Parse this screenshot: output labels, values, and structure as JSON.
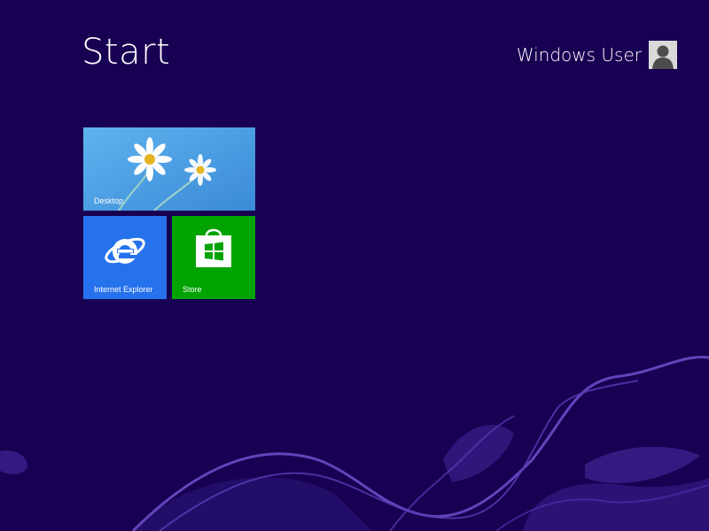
{
  "screen": {
    "title": "Start",
    "background_color": "#180052"
  },
  "user": {
    "name": "Windows User",
    "avatar_icon": "user-avatar-icon"
  },
  "tiles": [
    {
      "label": "Desktop",
      "color": "#4a9de2",
      "icon": "daisy-wallpaper"
    },
    {
      "label": "Internet Explorer",
      "color": "#2672ec",
      "icon": "internet-explorer-icon"
    },
    {
      "label": "Store",
      "color": "#00a300",
      "icon": "store-bag-icon"
    }
  ]
}
